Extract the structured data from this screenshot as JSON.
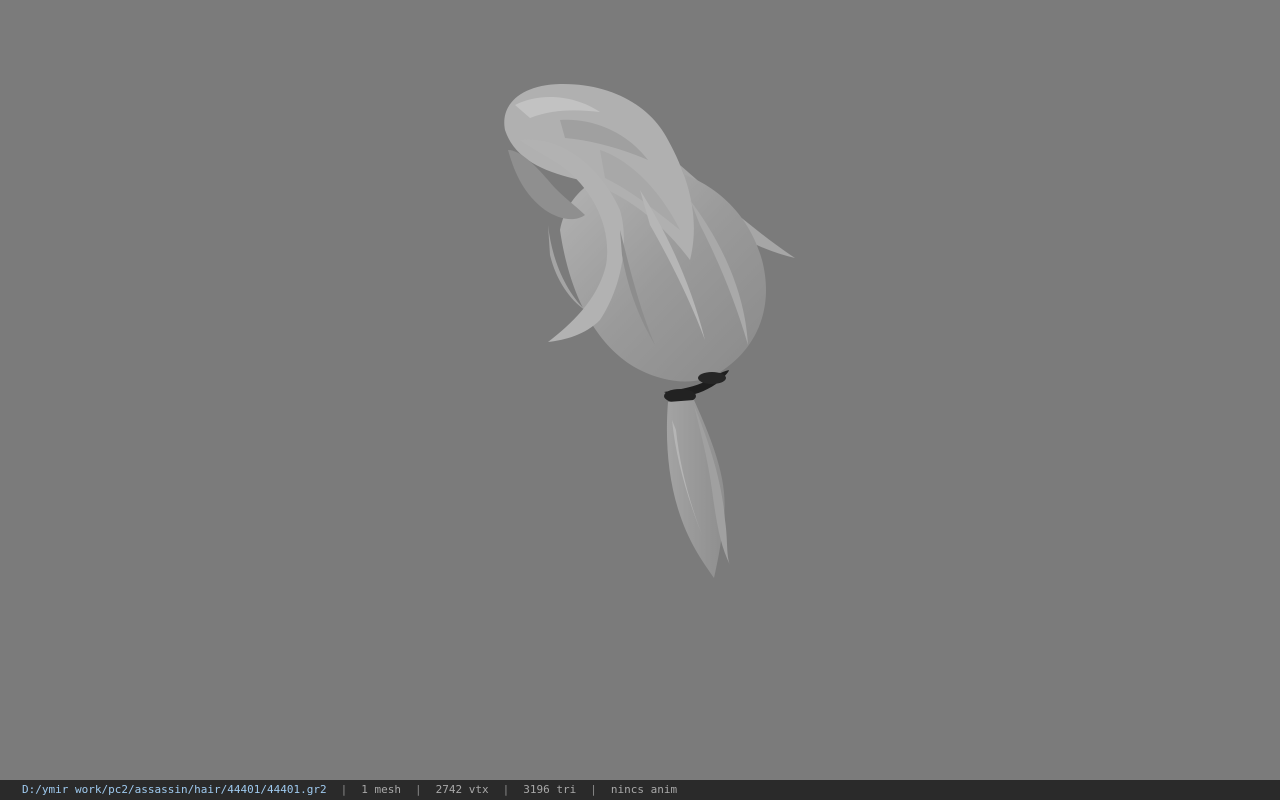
{
  "viewport": {
    "background_color": "#7b7b7b",
    "model_color": "#9a9a9a",
    "band_color": "#1e1e1e"
  },
  "status_bar": {
    "file_path": "D:/ymir work/pc2/assassin/hair/44401/44401.gr2",
    "separator": "|",
    "mesh_count": "1 mesh",
    "vertex_count": "2742 vtx",
    "triangle_count": "3196 tri",
    "anim_status": "nincs anim",
    "path_color": "#9ec9ee",
    "background_color": "#2a2a2a"
  }
}
